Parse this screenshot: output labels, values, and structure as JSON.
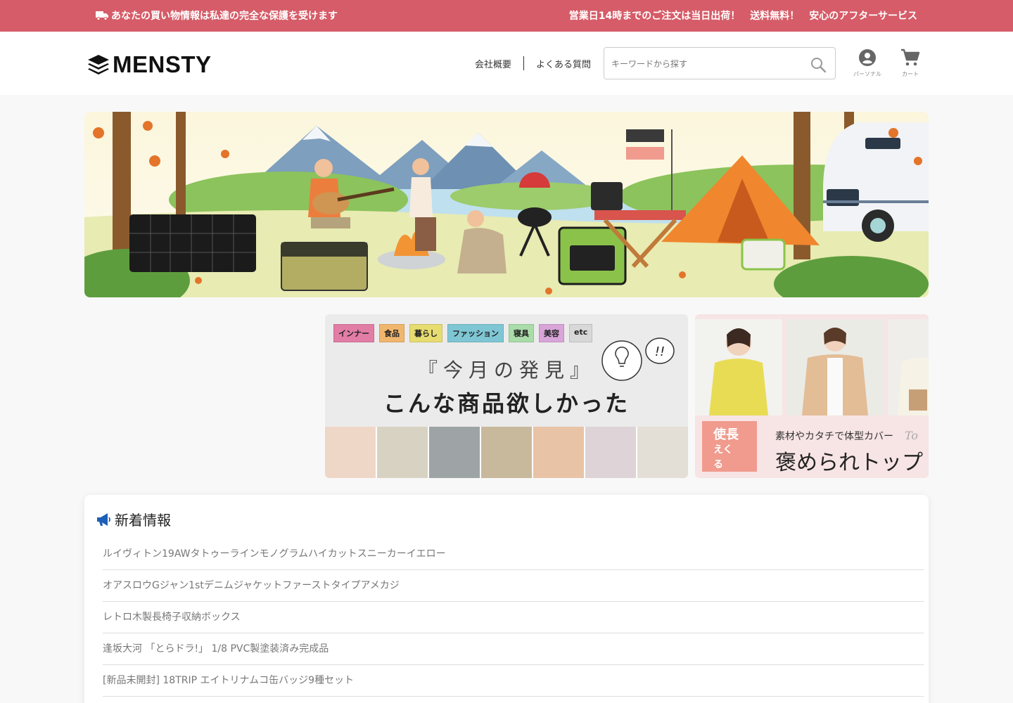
{
  "topbar": {
    "left_text": "あなたの買い物情報は私達の完全な保護を受けます",
    "right_items": [
      "営業日14時までのご注文は当日出荷！",
      "送料無料！",
      "安心のアフターサービス"
    ]
  },
  "header": {
    "logo_text": "MENSTY",
    "nav": [
      "会社概要",
      "よくある質問"
    ],
    "search_placeholder": "キーワードから探す",
    "account_label": "パーソナル",
    "cart_label": "カート"
  },
  "promo1": {
    "tags": [
      {
        "label": "インナー",
        "color": "#e27da5"
      },
      {
        "label": "食品",
        "color": "#f1b66e"
      },
      {
        "label": "暮らし",
        "color": "#e6dc70"
      },
      {
        "label": "ファッション",
        "color": "#7ec6d4"
      },
      {
        "label": "寝具",
        "color": "#a9dca9"
      },
      {
        "label": "美容",
        "color": "#d9a5d9"
      },
      {
        "label": "etc",
        "color": "#d8d8d8"
      }
    ],
    "subtitle": "『今月の発見』",
    "title": "こんな商品欲しかった",
    "bubble": "!!"
  },
  "promo2": {
    "badge_line1": "使長",
    "badge_line2": "えく",
    "badge_line3": "る",
    "small_text": "素材やカタチで体型カバー",
    "big_text": "褒められトップ",
    "to_text": "To"
  },
  "news": {
    "title": "新着情報",
    "items": [
      "ルイヴィトン19AWタトゥーラインモノグラムハイカットスニーカーイエロー",
      "オアスロウGジャン1stデニムジャケットファーストタイプアメカジ",
      "レトロ木製長椅子収納ボックス",
      "逢坂大河 「とらドラ!」 1/8 PVC製塗装済み完成品",
      "[新品未開封] 18TRIP エイトリナムコ缶バッジ9種セット",
      ""
    ]
  },
  "colors": {
    "topbar": "#d55c68",
    "promo_badge": "#f09b8e"
  }
}
